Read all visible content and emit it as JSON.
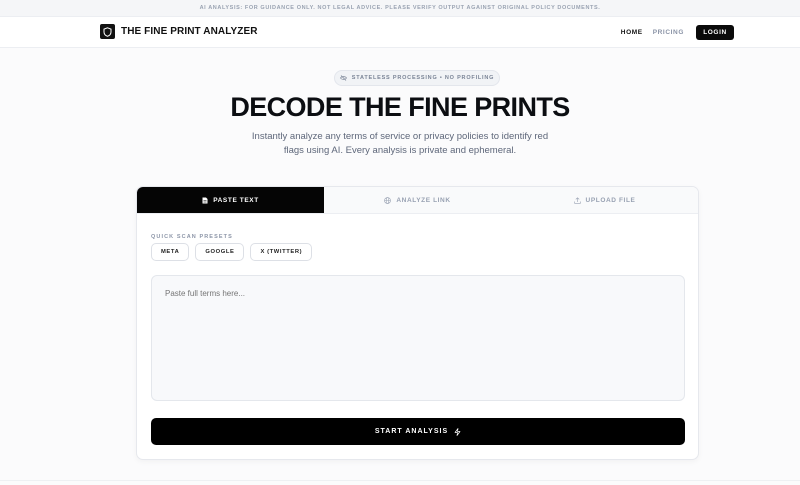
{
  "banner": {
    "text": "AI ANALYSIS: FOR GUIDANCE ONLY. NOT LEGAL ADVICE. PLEASE VERIFY OUTPUT AGAINST ORIGINAL POLICY DOCUMENTS."
  },
  "nav": {
    "brand": "THE FINE PRINT ANALYZER",
    "links": {
      "home": "HOME",
      "pricing": "PRICING"
    },
    "login": "LOGIN"
  },
  "hero": {
    "pill": "STATELESS PROCESSING • NO PROFILING",
    "title": "DECODE THE FINE PRINTS",
    "subtitle": "Instantly analyze any terms of service or privacy policies to identify red flags using AI. Every analysis is private and ephemeral."
  },
  "card": {
    "tabs": [
      {
        "label": "PASTE TEXT",
        "icon": "document-icon"
      },
      {
        "label": "ANALYZE LINK",
        "icon": "globe-icon"
      },
      {
        "label": "UPLOAD FILE",
        "icon": "upload-icon"
      }
    ],
    "presets_label": "QUICK SCAN PRESETS",
    "presets": [
      "META",
      "GOOGLE",
      "X (TWITTER)"
    ],
    "textarea": {
      "placeholder": "Paste full terms here...",
      "value": ""
    },
    "start_button": "START ANALYSIS"
  },
  "colors": {
    "accent": "#000000",
    "muted": "#8a93a6",
    "background": "#fbfbfc"
  }
}
